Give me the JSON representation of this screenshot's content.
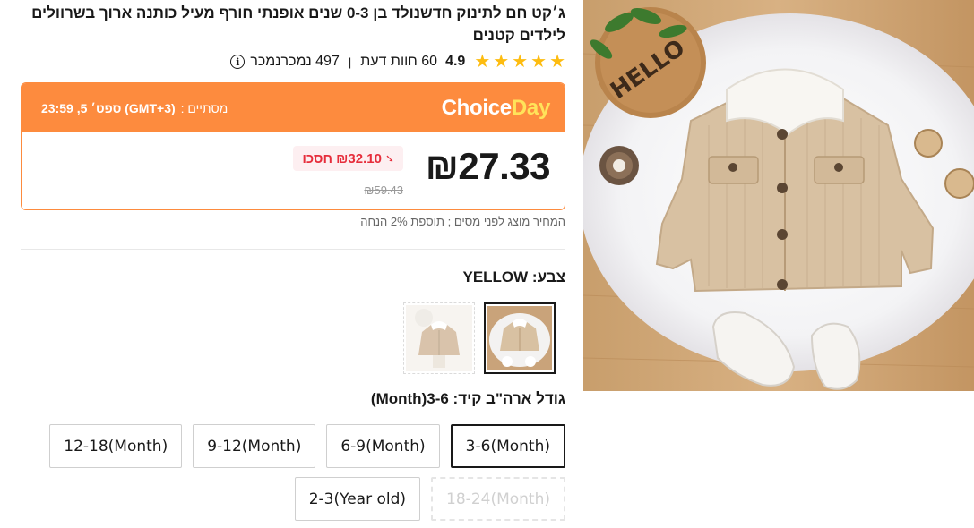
{
  "product": {
    "title": "ג׳קט חם לתינוק חדשנולד בן 0-3 שנים אופנתי חורף מעיל כותנה ארוך בשרוולים לילדים קטנים",
    "rating": "4.9",
    "reviews": "60 חוות דעת",
    "sold": "497 נמכרנמכר",
    "separator": "|"
  },
  "promo": {
    "brand_main": "Choice",
    "brand_accent": "Day",
    "ends_label": "מסתיים :",
    "ends_time": "ספט׳ 5, 23:59 (GMT+3)"
  },
  "price": {
    "current": "₪27.33",
    "save": "₪32.10 חסכו",
    "original": "₪59.43",
    "tax_note": "המחיר מוצג לפני מסים ; תוספת 2% הנחה"
  },
  "color": {
    "label": "צבע:",
    "value": "YELLOW",
    "label_full": "צבע: YELLOW"
  },
  "size": {
    "label_full": "גודל ארה\"ב קיד: 3-6(Month)",
    "options": [
      {
        "label": "3-6(Month)",
        "state": "selected"
      },
      {
        "label": "6-9(Month)",
        "state": "normal"
      },
      {
        "label": "9-12(Month)",
        "state": "normal"
      },
      {
        "label": "12-18(Month)",
        "state": "normal"
      },
      {
        "label": "18-24(Month)",
        "state": "disabled"
      },
      {
        "label": "2-3(Year old)",
        "state": "normal"
      }
    ]
  },
  "colors": {
    "accent_orange": "#fd8b3e",
    "star": "#fdbc10",
    "save_red": "#e62e3c",
    "day_yellow": "#ffe35a"
  },
  "icons": [
    "star-icon",
    "info-icon",
    "down-arrow-icon"
  ]
}
